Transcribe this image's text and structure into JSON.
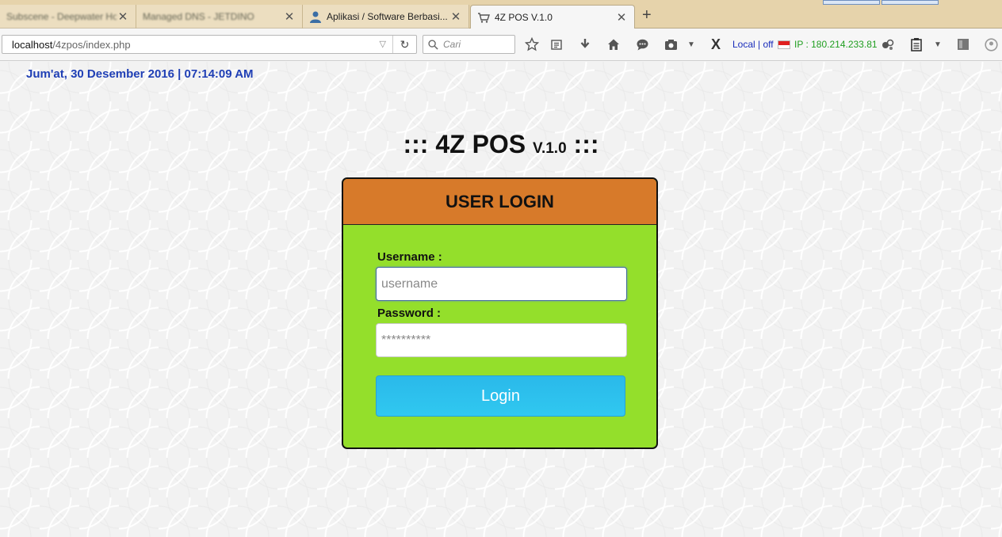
{
  "browser": {
    "tabs": [
      {
        "title": "Subscene - Deepwater Ho...",
        "active": false,
        "blurred": true
      },
      {
        "title": "Managed DNS - JETDINO",
        "active": false,
        "blurred": true
      },
      {
        "title": "Aplikasi / Software Berbasi...",
        "active": false,
        "blurred": false
      },
      {
        "title": "4Z POS V.1.0",
        "active": true,
        "blurred": false
      }
    ],
    "url_host": "localhost",
    "url_path": "/4zpos/index.php",
    "search_placeholder": "Cari",
    "addon_status": "Local | off",
    "addon_ip": "IP : 180.214.233.81",
    "icons": [
      "bookmark-star-icon",
      "reading-list-icon",
      "download-icon",
      "home-icon",
      "chat-icon",
      "screenshot-icon",
      "x-addon-icon",
      "flag-indonesia-icon",
      "extension-icon",
      "clipboard-icon",
      "sidebar-icon",
      "account-icon"
    ]
  },
  "page": {
    "datetime": "Jum'at, 30 Desember 2016 | 07:14:09 AM",
    "title_main": "::: 4Z POS ",
    "title_version": "V.1.0",
    "title_tail": " :::",
    "login": {
      "header": "USER LOGIN",
      "username_label": "Username :",
      "username_placeholder": "username",
      "password_label": "Password :",
      "password_placeholder": "**********",
      "button_label": "Login"
    }
  },
  "colors": {
    "login_header": "#d77a2a",
    "login_body": "#94df2b",
    "login_button": "#2ab9ea",
    "datetime_text": "#1f3fb5",
    "ip_text": "#1f9e1f"
  }
}
